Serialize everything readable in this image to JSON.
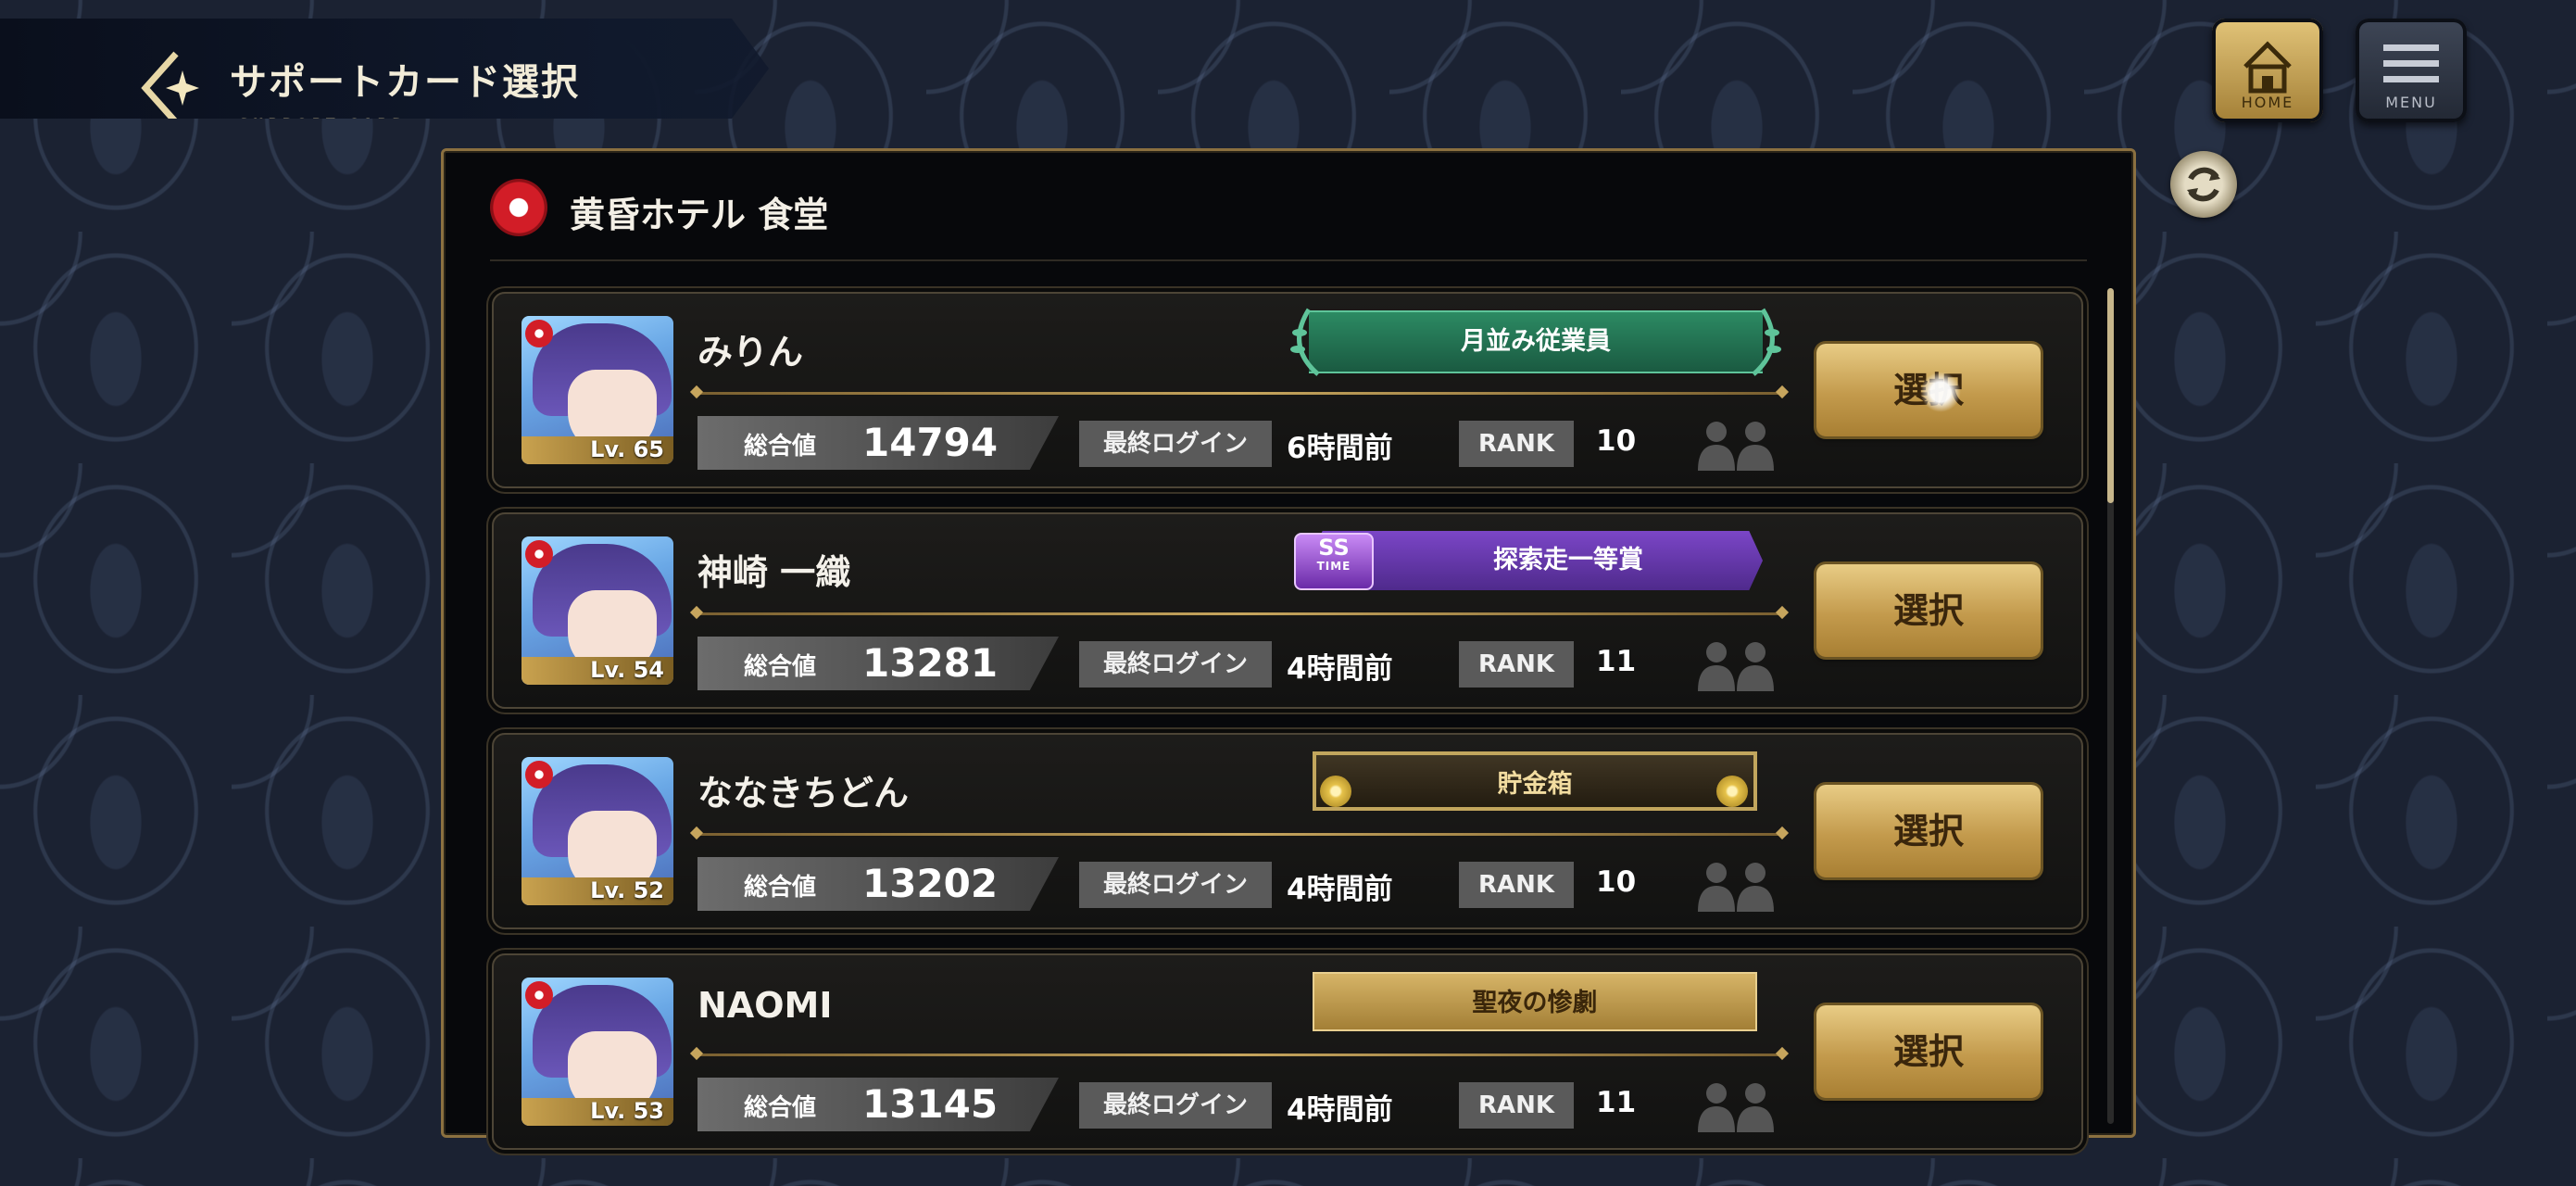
{
  "header": {
    "title": "サポートカード選択",
    "subtitle": "SUPPORT CARD",
    "home_label": "HOME",
    "menu_label": "MENU"
  },
  "location": {
    "name": "黄昏ホテル 食堂"
  },
  "labels": {
    "total": "総合値",
    "last_login": "最終ログイン",
    "rank": "RANK",
    "select": "選択"
  },
  "colors": {
    "accent_gold": "#c6a55d",
    "panel_border": "#8b7040",
    "background": "#1b2232"
  },
  "players": [
    {
      "name": "みりん",
      "level": "Lv. 65",
      "total": "14794",
      "last_login": "6時間前",
      "rank": "10",
      "title": "月並み従業員",
      "title_style": "green"
    },
    {
      "name": "神崎 一織",
      "level": "Lv. 54",
      "total": "13281",
      "last_login": "4時間前",
      "rank": "11",
      "title": "探索走一等賞",
      "title_style": "purple",
      "title_badge": "SS",
      "title_badge_sub": "TIME"
    },
    {
      "name": "ななきちどん",
      "level": "Lv. 52",
      "total": "13202",
      "last_login": "4時間前",
      "rank": "10",
      "title": "貯金箱",
      "title_style": "gold-dark"
    },
    {
      "name": "NAOMI",
      "level": "Lv. 53",
      "total": "13145",
      "last_login": "4時間前",
      "rank": "11",
      "title": "聖夜の惨劇",
      "title_style": "gold"
    }
  ]
}
